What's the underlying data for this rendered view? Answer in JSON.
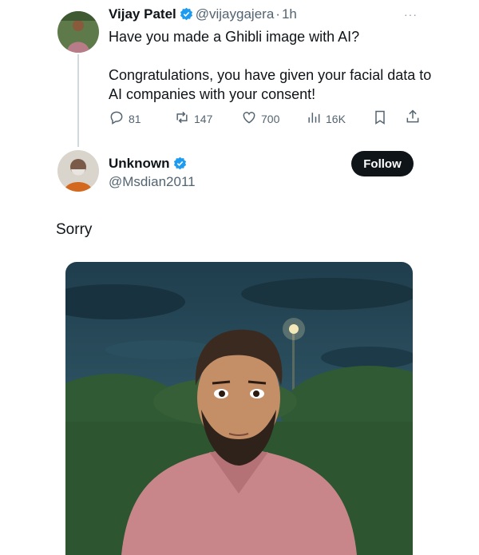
{
  "tweet": {
    "author_name": "Vijay Patel",
    "author_handle": "@vijaygajera",
    "separator": "·",
    "time": "1h",
    "more_label": "···",
    "text": "Have you made a Ghibli image with AI?\n\nCongratulations, you have given your facial data to AI companies with your consent!",
    "metrics": {
      "replies": "81",
      "reposts": "147",
      "likes": "700",
      "views": "16K"
    }
  },
  "reply_user": {
    "name": "Unknown",
    "handle": "@Msdian2011",
    "follow_label": "Follow"
  },
  "reply_text": "Sorry",
  "colors": {
    "verified": "#1d9bf0",
    "text": "#0f1419",
    "muted": "#536471",
    "follow_bg": "#0f1419"
  }
}
